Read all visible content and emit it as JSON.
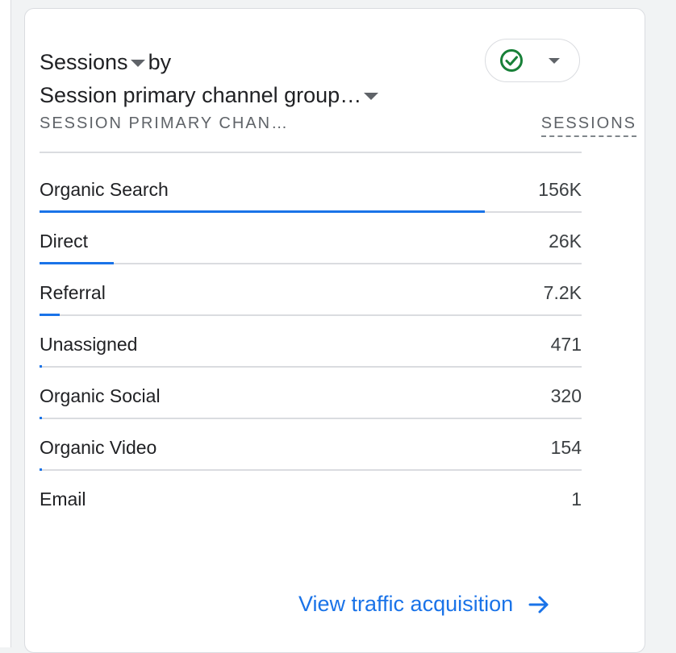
{
  "card": {
    "metric_label": "Sessions",
    "by_label": "by",
    "dimension_label": "Session primary channel group…",
    "status_icon": "check-circle-icon",
    "columns": {
      "dimension": "SESSION PRIMARY CHAN…",
      "metric": "SESSIONS"
    },
    "rows": [
      {
        "label": "Organic Search",
        "value": "156K",
        "share": 1.0
      },
      {
        "label": "Direct",
        "value": "26K",
        "share": 0.167
      },
      {
        "label": "Referral",
        "value": "7.2K",
        "share": 0.046
      },
      {
        "label": "Unassigned",
        "value": "471",
        "share": 0.003
      },
      {
        "label": "Organic Social",
        "value": "320",
        "share": 0.002
      },
      {
        "label": "Organic Video",
        "value": "154",
        "share": 0.001
      },
      {
        "label": "Email",
        "value": "1",
        "share": 0.0
      }
    ],
    "footer_link": "View traffic acquisition"
  },
  "colors": {
    "accent": "#1a73e8",
    "success": "#188038",
    "divider": "#dadce0"
  }
}
